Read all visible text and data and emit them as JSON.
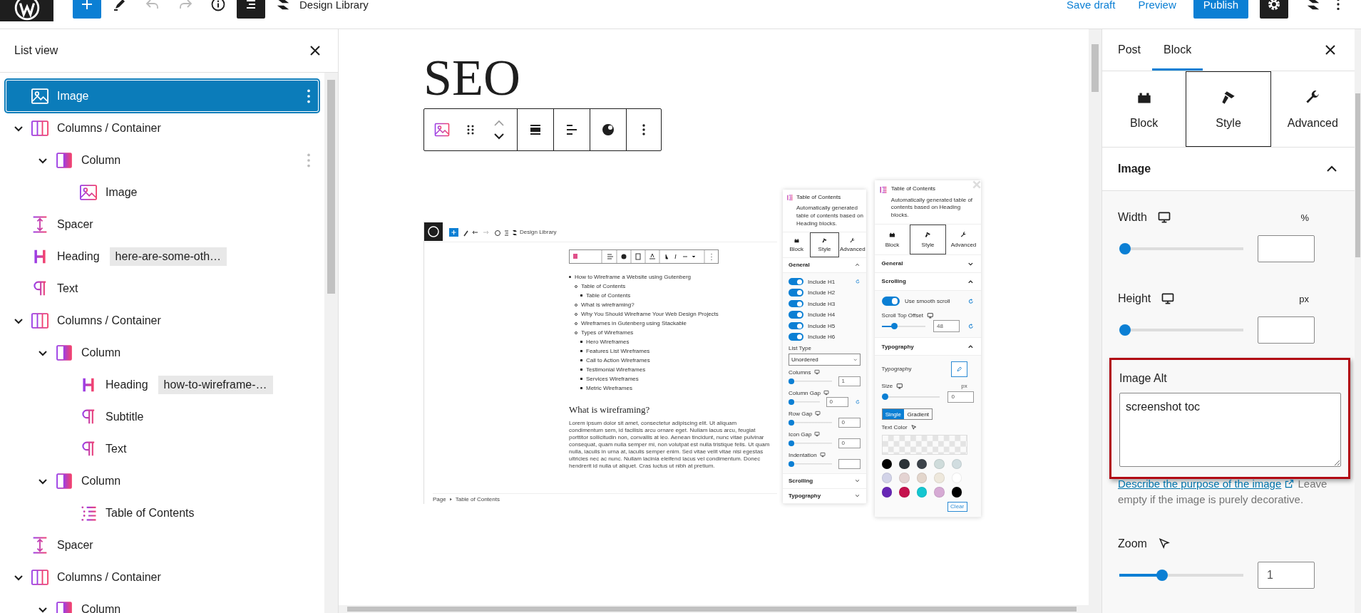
{
  "top_bar": {
    "tools": [
      {
        "kind": "inserter",
        "pressed": false,
        "disabled": false
      },
      {
        "kind": "tools",
        "pressed": false,
        "disabled": false
      },
      {
        "kind": "undo",
        "pressed": false,
        "disabled": true
      },
      {
        "kind": "redo",
        "pressed": false,
        "disabled": true
      },
      {
        "kind": "details",
        "pressed": false,
        "disabled": false
      },
      {
        "kind": "list_view",
        "pressed": true,
        "disabled": false
      }
    ],
    "library": "Design Library",
    "save_draft": "Save draft",
    "preview": "Preview",
    "publish": "Publish",
    "settings_pressed": true
  },
  "list_view": {
    "title": "List view",
    "items": [
      {
        "label": "Image",
        "kind": "image",
        "selected": true,
        "hovered": false
      },
      {
        "label": "Columns / Container",
        "kind": "columns",
        "selected": false,
        "hovered": false,
        "expanded": true,
        "children": [
          {
            "label": "Column",
            "kind": "column",
            "selected": false,
            "hovered": true,
            "expanded": true,
            "children": [
              {
                "label": "Image",
                "kind": "image",
                "selected": false,
                "hovered": false
              }
            ]
          }
        ]
      },
      {
        "label": "Spacer",
        "kind": "spacer",
        "selected": false,
        "hovered": false
      },
      {
        "label": "Heading",
        "kind": "heading",
        "anchor": "here-are-some-oth…",
        "selected": false,
        "hovered": false
      },
      {
        "label": "Text",
        "kind": "paragraph",
        "selected": false,
        "hovered": false
      },
      {
        "label": "Columns / Container",
        "kind": "columns",
        "selected": false,
        "hovered": false,
        "expanded": true,
        "children": [
          {
            "label": "Column",
            "kind": "column",
            "selected": false,
            "hovered": false,
            "expanded": true,
            "children": [
              {
                "label": "Heading",
                "kind": "heading",
                "anchor": "how-to-wireframe-…",
                "selected": false,
                "hovered": false
              },
              {
                "label": "Subtitle",
                "kind": "paragraph",
                "selected": false,
                "hovered": false
              },
              {
                "label": "Text",
                "kind": "paragraph",
                "selected": false,
                "hovered": false
              }
            ]
          },
          {
            "label": "Column",
            "kind": "column",
            "selected": false,
            "hovered": false,
            "expanded": true,
            "children": [
              {
                "label": "Table of Contents",
                "kind": "toc",
                "selected": false,
                "hovered": false
              }
            ]
          }
        ]
      },
      {
        "label": "Spacer",
        "kind": "spacer",
        "selected": false,
        "hovered": false
      },
      {
        "label": "Columns / Container",
        "kind": "columns",
        "selected": false,
        "hovered": false,
        "expanded": true,
        "children": [
          {
            "label": "Column",
            "kind": "column",
            "selected": false,
            "hovered": false,
            "expanded": true
          }
        ]
      }
    ]
  },
  "canvas": {
    "heading": "SEO",
    "image": {
      "editor": {
        "library": "Design Library",
        "toc": [
          {
            "text": "How to Wireframe a Website using Gutenberg",
            "children": [
              {
                "text": "Table of Contents",
                "children": [
                  {
                    "text": "Table of Contents"
                  }
                ]
              },
              {
                "text": "What is wireframing?"
              },
              {
                "text": "Why You Should Wireframe Your Web Design Projects"
              },
              {
                "text": "Wireframes in Gutenberg using Stackable"
              },
              {
                "text": "Types of Wireframes",
                "children": [
                  {
                    "text": "Hero Wireframes"
                  },
                  {
                    "text": "Features List Wireframes"
                  },
                  {
                    "text": "Call to Action Wireframes"
                  },
                  {
                    "text": "Testimonial Wireframes"
                  },
                  {
                    "text": "Services Wireframes"
                  },
                  {
                    "text": "Metric Wireframes"
                  }
                ]
              }
            ]
          }
        ],
        "heading": "What is wireframing?",
        "paragraph": "Lorem ipsum dolor sit amet, consectetur adipiscing elit. Ut aliquam condimentum sem, id facilisis arcu ornare eget. Nullam lacus arcu, feugiat porttitor sollicitudin non, convallis at leo. Aenean tincidunt, nunc vitae pulvinar consequat, quam nulla semper mi, non volutpat est nulla tristique felis. Ut quam nulla, iaculis in urna at, iaculis semper enim. Sed vitae velit vitae nisi egestas ultricies nec ac nunc. Nullam lacinia eleifend lacus vel condimentum. Donec hendrerit id nulla ut aliquet. Cras luctus ut nibh at pretium.",
        "breadcrumb": [
          "Page",
          "Table of Contents"
        ]
      },
      "panels": [
        {
          "title": "Table of Contents",
          "description": "Automatically generated table of contents based on Heading blocks.",
          "tabs": [
            {
              "kind": "block",
              "label": "Block",
              "selected": false
            },
            {
              "kind": "style",
              "label": "Style",
              "selected": true
            },
            {
              "kind": "advanced",
              "label": "Advanced",
              "selected": false
            }
          ],
          "sections": [
            {
              "title": "General",
              "expanded": true,
              "controls": [
                {
                  "kind": "toggle",
                  "label": "Include H1",
                  "on": true,
                  "reset": true
                },
                {
                  "kind": "toggle",
                  "label": "Include H2",
                  "on": true
                },
                {
                  "kind": "toggle",
                  "label": "Include H3",
                  "on": true
                },
                {
                  "kind": "toggle",
                  "label": "Include H4",
                  "on": true
                },
                {
                  "kind": "toggle",
                  "label": "Include H5",
                  "on": true
                },
                {
                  "kind": "toggle",
                  "label": "Include H6",
                  "on": true
                },
                {
                  "kind": "select",
                  "label": "List Type",
                  "value": "Unordered"
                },
                {
                  "kind": "slider",
                  "label": "Columns",
                  "level": 0,
                  "value": "1"
                },
                {
                  "kind": "slider",
                  "label": "Column Gap",
                  "level": 0,
                  "value": "0",
                  "reset": true
                },
                {
                  "kind": "slider",
                  "label": "Row Gap",
                  "level": 0,
                  "value": "0"
                },
                {
                  "kind": "slider",
                  "label": "Icon Gap",
                  "level": 0,
                  "value": "0"
                },
                {
                  "kind": "slider",
                  "label": "Indentation",
                  "level": 0
                }
              ]
            },
            {
              "title": "Scrolling",
              "expanded": false
            },
            {
              "title": "Typography",
              "expanded": false
            }
          ]
        },
        {
          "title": "Table of Contents",
          "description": "Automatically generated table of contents based on Heading blocks.",
          "tabs": [
            {
              "kind": "block",
              "label": "Block",
              "selected": false
            },
            {
              "kind": "style",
              "label": "Style",
              "selected": true
            },
            {
              "kind": "advanced",
              "label": "Advanced",
              "selected": false
            }
          ],
          "sections": [
            {
              "title": "General",
              "expanded": false
            },
            {
              "title": "Scrolling",
              "expanded": true,
              "controls": [
                {
                  "kind": "toggle",
                  "label": "Use smooth scroll",
                  "on": true,
                  "reset": true
                },
                {
                  "kind": "slider",
                  "label": "Scroll Top Offset",
                  "level": 0.25,
                  "value": "48",
                  "reset": true
                }
              ]
            },
            {
              "title": "Typography",
              "expanded": true,
              "controls": [
                {
                  "kind": "style_button",
                  "label": "Typography"
                },
                {
                  "kind": "slider",
                  "label": "Size",
                  "unit": "px",
                  "level": 0,
                  "value": "0"
                },
                {
                  "kind": "segmented",
                  "options": [
                    {
                      "label": "Single",
                      "selected": true
                    },
                    {
                      "label": "Gradient",
                      "selected": false
                    }
                  ]
                },
                {
                  "kind": "colors",
                  "label": "Text Color",
                  "clear": "Clear",
                  "swatches": [
                    {
                      "color": "#000000"
                    },
                    {
                      "color": "#2c3338"
                    },
                    {
                      "color": "#3c434a"
                    },
                    {
                      "color": "#cfdcdb"
                    },
                    {
                      "color": "#d1dde0"
                    },
                    {
                      "color": "#d2d3e8"
                    },
                    {
                      "color": "#e4d3d2"
                    },
                    {
                      "color": "#e3d6cc"
                    },
                    {
                      "color": "#eee8dc"
                    },
                    {
                      "color": "#ffffff"
                    },
                    {
                      "color": "#6727b5"
                    },
                    {
                      "color": "#c5114d"
                    },
                    {
                      "color": "#14c6d0"
                    },
                    {
                      "color": "#d6aad4"
                    },
                    {
                      "color": "#000000"
                    }
                  ]
                }
              ]
            }
          ]
        }
      ]
    }
  },
  "sidebar": {
    "tabs": [
      {
        "label": "Post",
        "selected": false
      },
      {
        "label": "Block",
        "selected": true
      }
    ],
    "style_tabs": [
      {
        "kind": "block",
        "label": "Block",
        "selected": false
      },
      {
        "kind": "style",
        "label": "Style",
        "selected": true
      },
      {
        "kind": "advanced",
        "label": "Advanced",
        "selected": false
      }
    ],
    "section": {
      "title": "Image",
      "expanded": true
    },
    "controls": [
      {
        "kind": "responsive_slider",
        "label": "Width",
        "unit": "%",
        "level": 0
      },
      {
        "kind": "responsive_slider",
        "label": "Height",
        "unit": "px",
        "level": 0
      },
      {
        "kind": "textarea",
        "label": "Image Alt",
        "value": "screenshot toc",
        "highlighted": true,
        "help_link": "Describe the purpose of the image",
        "help": "Leave empty if the image is purely decorative."
      },
      {
        "kind": "hover_slider",
        "label": "Zoom",
        "level": 0.33,
        "value": "1"
      }
    ]
  }
}
